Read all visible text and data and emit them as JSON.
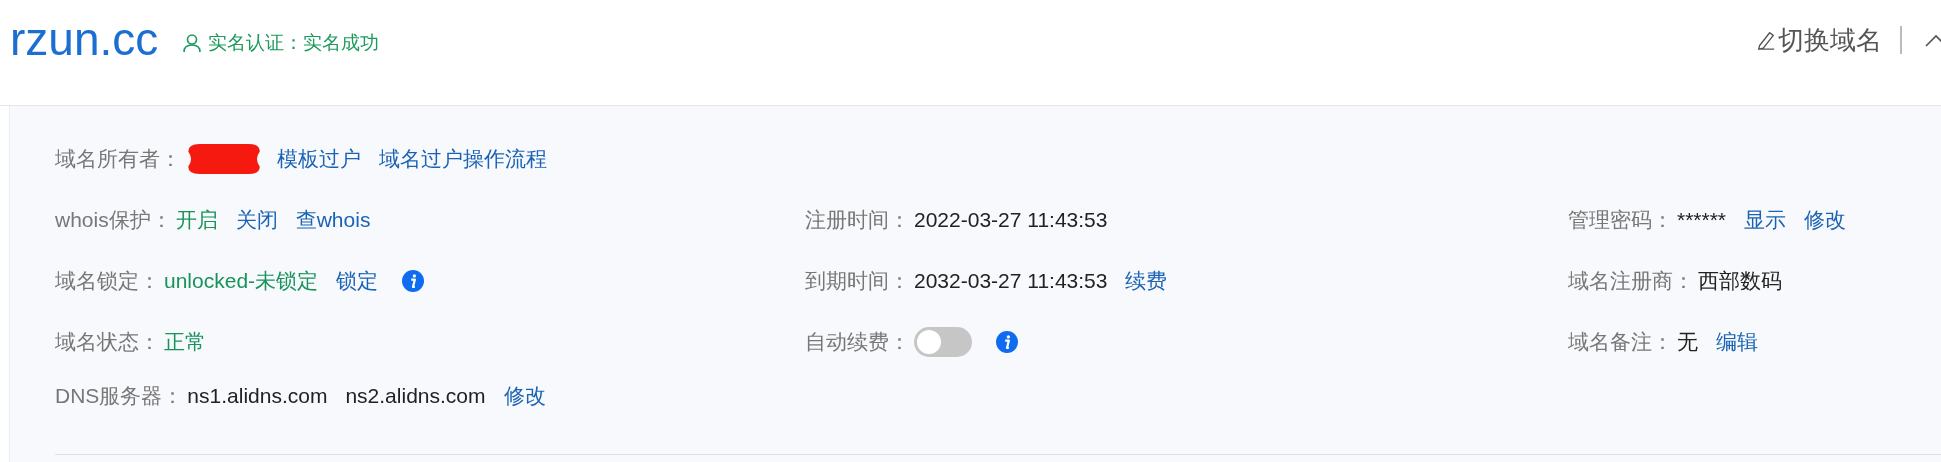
{
  "header": {
    "domain": "rzun.cc",
    "verification": "实名认证：实名成功",
    "switch_domain": "切换域名"
  },
  "rows": [
    {
      "left": {
        "label": "域名所有者：",
        "parts": [
          {
            "kind": "redacted"
          },
          {
            "kind": "link",
            "text": "模板过户"
          },
          {
            "kind": "link",
            "text": "域名过户操作流程"
          }
        ]
      }
    },
    {
      "left": {
        "label": "whois保护：",
        "parts": [
          {
            "kind": "status",
            "text": "开启"
          },
          {
            "kind": "link",
            "text": "关闭"
          },
          {
            "kind": "link",
            "text": "查whois"
          }
        ]
      },
      "middle": {
        "label": "注册时间：",
        "parts": [
          {
            "kind": "value",
            "text": "2022-03-27 11:43:53"
          }
        ]
      },
      "right": {
        "label": "管理密码：",
        "parts": [
          {
            "kind": "value",
            "text": "******"
          },
          {
            "kind": "link",
            "text": "显示"
          },
          {
            "kind": "link",
            "text": "修改"
          }
        ]
      }
    },
    {
      "left": {
        "label": "域名锁定：",
        "parts": [
          {
            "kind": "status",
            "text": "unlocked-未锁定"
          },
          {
            "kind": "link",
            "text": "锁定"
          },
          {
            "kind": "info"
          }
        ]
      },
      "middle": {
        "label": "到期时间：",
        "parts": [
          {
            "kind": "value",
            "text": "2032-03-27 11:43:53"
          },
          {
            "kind": "link",
            "text": "续费"
          }
        ]
      },
      "right": {
        "label": "域名注册商：",
        "parts": [
          {
            "kind": "value",
            "text": "西部数码"
          }
        ]
      }
    },
    {
      "left": {
        "label": "域名状态：",
        "parts": [
          {
            "kind": "status",
            "text": "正常"
          }
        ]
      },
      "middle": {
        "label": "自动续费：",
        "parts": [
          {
            "kind": "switch",
            "on": false
          },
          {
            "kind": "info"
          }
        ]
      },
      "right": {
        "label": "域名备注：",
        "parts": [
          {
            "kind": "value",
            "text": "无"
          },
          {
            "kind": "link",
            "text": "编辑"
          }
        ]
      }
    },
    {
      "left": {
        "label": "DNS服务器：",
        "parts": [
          {
            "kind": "value",
            "text": "ns1.alidns.com"
          },
          {
            "kind": "value",
            "text": "ns2.alidns.com"
          },
          {
            "kind": "link",
            "text": "修改"
          }
        ]
      }
    }
  ]
}
